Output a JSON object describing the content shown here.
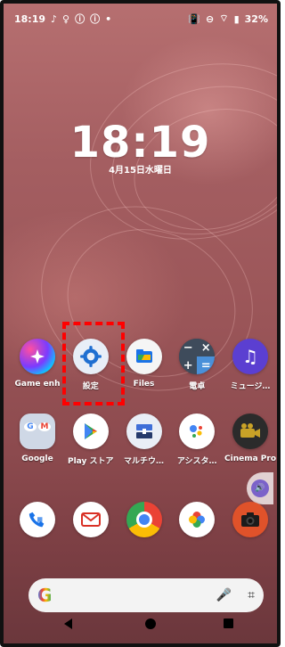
{
  "status_bar": {
    "time": "18:19",
    "left_icons": [
      "music-note-icon",
      "pin-icon",
      "info-icon",
      "info-icon",
      "dot-icon"
    ],
    "right_icons": [
      "vibrate-icon",
      "dnd-icon",
      "wifi-icon",
      "battery-icon"
    ],
    "battery": "32%"
  },
  "lock_clock": {
    "time": "18:19",
    "date": "4月15日水曜日"
  },
  "apps_row1": [
    {
      "name": "Game enh",
      "icon": "game-enhancer-icon"
    },
    {
      "name": "設定",
      "icon": "settings-gear-icon"
    },
    {
      "name": "Files",
      "icon": "files-icon"
    },
    {
      "name": "電卓",
      "icon": "calculator-icon"
    },
    {
      "name": "ミュージ…",
      "icon": "music-icon"
    }
  ],
  "apps_row2": [
    {
      "name": "Google",
      "icon": "google-folder-icon"
    },
    {
      "name": "Play ストア",
      "icon": "play-store-icon"
    },
    {
      "name": "マルチウ…",
      "icon": "multiwindow-icon"
    },
    {
      "name": "アシスタ…",
      "icon": "assistant-icon"
    },
    {
      "name": "Cinema Pro",
      "icon": "cinema-pro-icon"
    }
  ],
  "dock": [
    {
      "icon": "phone-icon"
    },
    {
      "icon": "gmail-icon"
    },
    {
      "icon": "chrome-icon"
    },
    {
      "icon": "photos-icon"
    },
    {
      "icon": "camera-icon"
    }
  ],
  "search_bar": {
    "logo": "G",
    "mic_icon": "mic-icon",
    "lens_icon": "lens-icon"
  },
  "nav": {
    "back": "back-icon",
    "home": "home-icon",
    "recents": "recents-icon"
  },
  "colors": {
    "highlight": "#ff0000",
    "wallpaper": "#9a5558"
  }
}
